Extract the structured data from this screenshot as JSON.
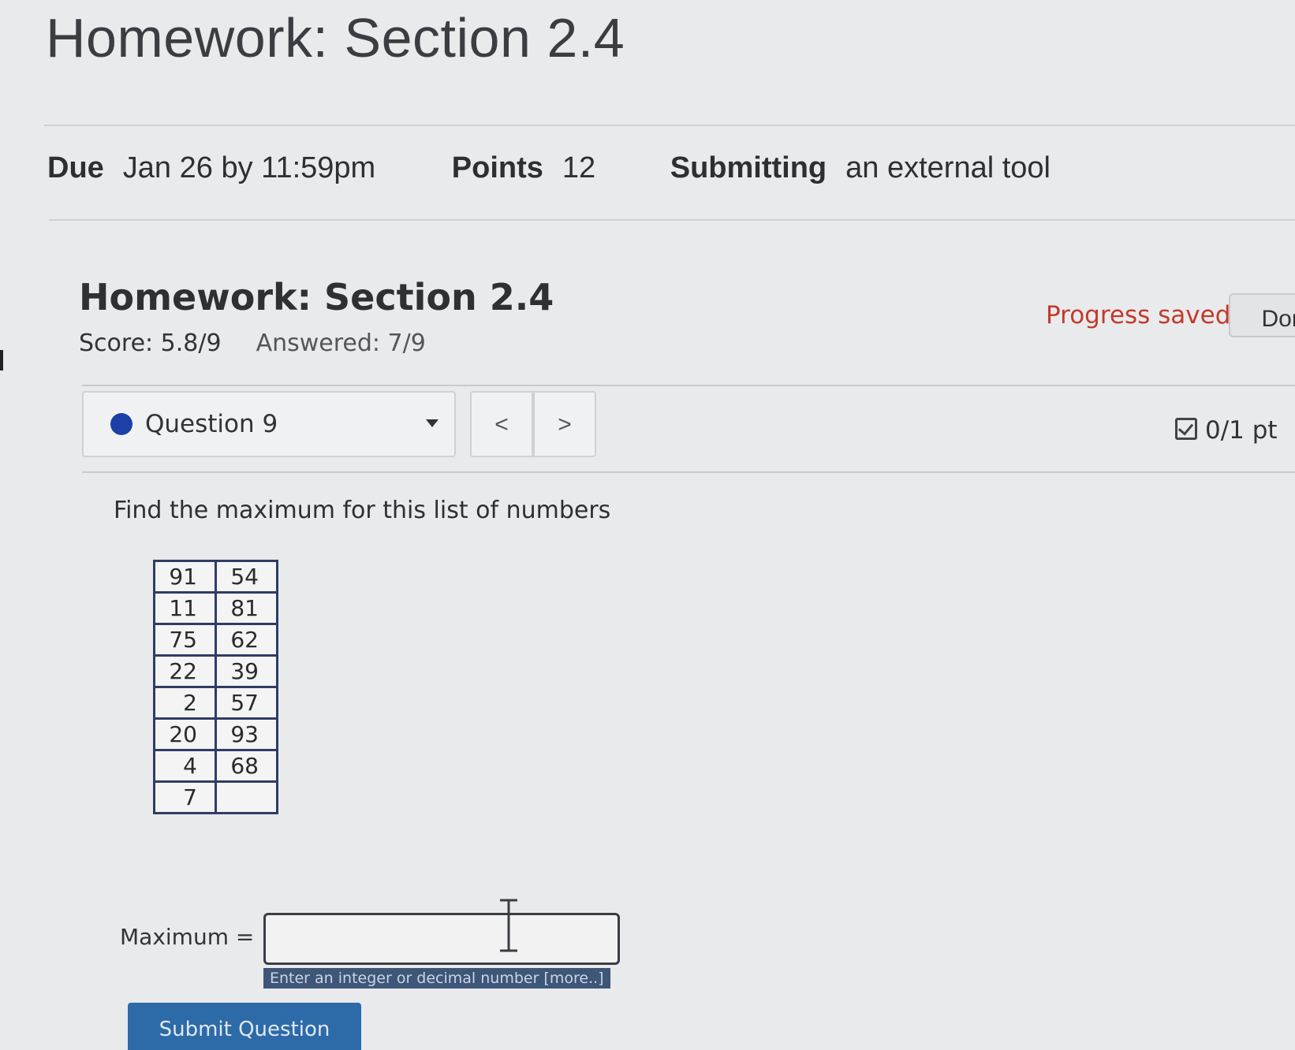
{
  "page": {
    "title": "Homework: Section 2.4"
  },
  "details": {
    "due_label": "Due",
    "due_value": "Jan 26 by 11:59pm",
    "points_label": "Points",
    "points_value": "12",
    "submitting_label": "Submitting",
    "submitting_value": "an external tool"
  },
  "assignment": {
    "title": "Homework: Section 2.4",
    "score": "Score: 5.8/9",
    "answered": "Answered: 7/9",
    "progress_status": "Progress saved",
    "done_label": "Don"
  },
  "question_nav": {
    "current": "Question 9",
    "prev_symbol": "<",
    "next_symbol": ">",
    "points": "0/1 pt",
    "status_color": "#1d3fa8"
  },
  "question": {
    "prompt": "Find the maximum for this list of numbers",
    "numbers": [
      [
        "91",
        "54"
      ],
      [
        "11",
        "81"
      ],
      [
        "75",
        "62"
      ],
      [
        "22",
        "39"
      ],
      [
        "2",
        "57"
      ],
      [
        "20",
        "93"
      ],
      [
        "4",
        "68"
      ],
      [
        "7",
        ""
      ]
    ],
    "answer_label": "Maximum =",
    "answer_value": "",
    "hint": "Enter an integer or decimal number [more..]",
    "submit_label": "Submit Question"
  },
  "icons": {
    "status_dot": "filled-circle-icon",
    "dropdown": "caret-down-icon",
    "points": "checkbox-icon",
    "text_cursor": "i-beam-cursor-icon"
  },
  "colors": {
    "progress_saved": "#c23a2b",
    "hint_background": "#3e5678",
    "submit_background": "#2d6aa8"
  }
}
